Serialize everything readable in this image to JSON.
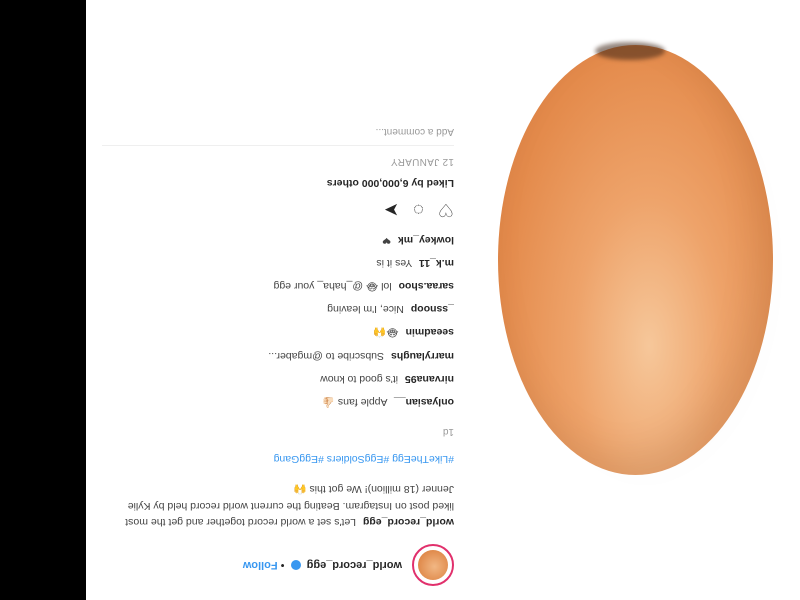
{
  "post": {
    "username": "world_record_egg",
    "separator": "•",
    "follow_label": "Follow",
    "caption_text": "Let's set a world record together and get the most liked post on Instagram. Beating the current world record held by Kylie Jenner (18 million)! We got this 🙌",
    "hashtags": "#LikeTheEgg #EggSoldiers #EggGang",
    "time_ago": "1d"
  },
  "comments": [
    {
      "user": "onlyasian__",
      "text": "Apple fans 👍🏻"
    },
    {
      "user": "nirvana95",
      "text": "it's good to know"
    },
    {
      "user": "marrylaughs",
      "text": "Subscribe to @mgaber..."
    },
    {
      "user": "seeadmin",
      "text": "😂🙌"
    },
    {
      "user": "_ssnoop",
      "text": "Nice, I'm leaving"
    },
    {
      "user": "saraa.shoo",
      "text": "lol 😂 @_haha_ your egg"
    },
    {
      "user": "m.k_11",
      "text": "Yes it is"
    },
    {
      "user": "lowkey_mk",
      "text": "❤"
    }
  ],
  "likes": {
    "text": "Liked by 6,000,000 others"
  },
  "date": {
    "text": "12 JANUARY"
  },
  "add_comment": {
    "placeholder": "Add a comment..."
  },
  "icons": [
    "heart-icon",
    "comment-icon",
    "share-icon",
    "bookmark-icon"
  ],
  "colors": {
    "accent": "#3897f0",
    "ring": "#e1306c",
    "egg": "#e48b4c"
  }
}
